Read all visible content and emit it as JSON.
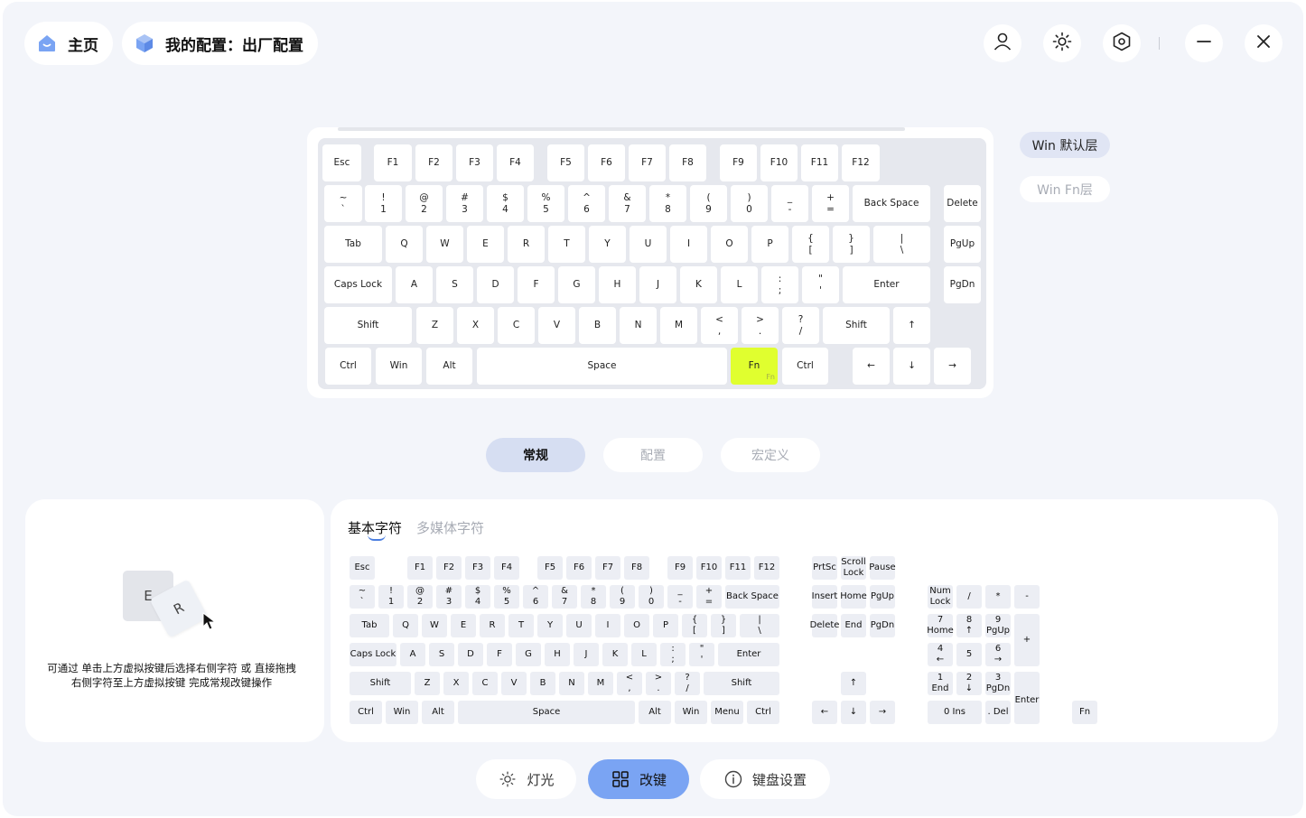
{
  "header": {
    "home_label": "主页",
    "config_label": "我的配置：出厂配置"
  },
  "layers": {
    "win_default": "Win 默认层",
    "win_fn": "Win Fn层"
  },
  "mid_tabs": [
    "常规",
    "配置",
    "宏定义"
  ],
  "keyboard": {
    "fn_sub": "Fn",
    "keys": [
      {
        "id": "esc",
        "t": [
          "Esc"
        ]
      },
      {
        "id": "f1",
        "t": [
          "F1"
        ]
      },
      {
        "id": "f2",
        "t": [
          "F2"
        ]
      },
      {
        "id": "f3",
        "t": [
          "F3"
        ]
      },
      {
        "id": "f4",
        "t": [
          "F4"
        ]
      },
      {
        "id": "f5",
        "t": [
          "F5"
        ]
      },
      {
        "id": "f6",
        "t": [
          "F6"
        ]
      },
      {
        "id": "f7",
        "t": [
          "F7"
        ]
      },
      {
        "id": "f8",
        "t": [
          "F8"
        ]
      },
      {
        "id": "f9",
        "t": [
          "F9"
        ]
      },
      {
        "id": "f10",
        "t": [
          "F10"
        ]
      },
      {
        "id": "f11",
        "t": [
          "F11"
        ]
      },
      {
        "id": "f12",
        "t": [
          "F12"
        ]
      },
      {
        "id": "grave",
        "t": [
          "~",
          "`"
        ]
      },
      {
        "id": "1",
        "t": [
          "!",
          "1"
        ]
      },
      {
        "id": "2",
        "t": [
          "@",
          "2"
        ]
      },
      {
        "id": "3",
        "t": [
          "#",
          "3"
        ]
      },
      {
        "id": "4",
        "t": [
          "$",
          "4"
        ]
      },
      {
        "id": "5",
        "t": [
          "%",
          "5"
        ]
      },
      {
        "id": "6",
        "t": [
          "^",
          "6"
        ]
      },
      {
        "id": "7",
        "t": [
          "&",
          "7"
        ]
      },
      {
        "id": "8",
        "t": [
          "*",
          "8"
        ]
      },
      {
        "id": "9",
        "t": [
          "(",
          "9"
        ]
      },
      {
        "id": "0",
        "t": [
          ")",
          "0"
        ]
      },
      {
        "id": "minus",
        "t": [
          "_",
          "-"
        ]
      },
      {
        "id": "equal",
        "t": [
          "+",
          "="
        ]
      },
      {
        "id": "backspace",
        "t": [
          "Back Space"
        ]
      },
      {
        "id": "delete",
        "t": [
          "Delete"
        ]
      },
      {
        "id": "tab",
        "t": [
          "Tab"
        ]
      },
      {
        "id": "q",
        "t": [
          "Q"
        ]
      },
      {
        "id": "w",
        "t": [
          "W"
        ]
      },
      {
        "id": "e",
        "t": [
          "E"
        ]
      },
      {
        "id": "r",
        "t": [
          "R"
        ]
      },
      {
        "id": "t",
        "t": [
          "T"
        ]
      },
      {
        "id": "y",
        "t": [
          "Y"
        ]
      },
      {
        "id": "u",
        "t": [
          "U"
        ]
      },
      {
        "id": "i",
        "t": [
          "I"
        ]
      },
      {
        "id": "o",
        "t": [
          "O"
        ]
      },
      {
        "id": "p",
        "t": [
          "P"
        ]
      },
      {
        "id": "lbracket",
        "t": [
          "{",
          "["
        ]
      },
      {
        "id": "rbracket",
        "t": [
          "}",
          "]"
        ]
      },
      {
        "id": "backslash",
        "t": [
          "|",
          "\\"
        ]
      },
      {
        "id": "pgup",
        "t": [
          "PgUp"
        ]
      },
      {
        "id": "capslock",
        "t": [
          "Caps Lock"
        ]
      },
      {
        "id": "a",
        "t": [
          "A"
        ]
      },
      {
        "id": "s",
        "t": [
          "S"
        ]
      },
      {
        "id": "d",
        "t": [
          "D"
        ]
      },
      {
        "id": "f",
        "t": [
          "F"
        ]
      },
      {
        "id": "g",
        "t": [
          "G"
        ]
      },
      {
        "id": "h",
        "t": [
          "H"
        ]
      },
      {
        "id": "j",
        "t": [
          "J"
        ]
      },
      {
        "id": "k",
        "t": [
          "K"
        ]
      },
      {
        "id": "l",
        "t": [
          "L"
        ]
      },
      {
        "id": "semicolon",
        "t": [
          ":",
          ";"
        ]
      },
      {
        "id": "quote",
        "t": [
          "\"",
          "'"
        ]
      },
      {
        "id": "enter",
        "t": [
          "Enter"
        ]
      },
      {
        "id": "pgdn",
        "t": [
          "PgDn"
        ]
      },
      {
        "id": "lshift",
        "t": [
          "Shift"
        ]
      },
      {
        "id": "z",
        "t": [
          "Z"
        ]
      },
      {
        "id": "x",
        "t": [
          "X"
        ]
      },
      {
        "id": "c",
        "t": [
          "C"
        ]
      },
      {
        "id": "v",
        "t": [
          "V"
        ]
      },
      {
        "id": "b",
        "t": [
          "B"
        ]
      },
      {
        "id": "n",
        "t": [
          "N"
        ]
      },
      {
        "id": "m",
        "t": [
          "M"
        ]
      },
      {
        "id": "comma",
        "t": [
          "<",
          ","
        ]
      },
      {
        "id": "period",
        "t": [
          ">",
          "."
        ]
      },
      {
        "id": "slash",
        "t": [
          "?",
          "/"
        ]
      },
      {
        "id": "rshift",
        "t": [
          "Shift"
        ]
      },
      {
        "id": "up",
        "t": [
          "↑"
        ]
      },
      {
        "id": "lctrl",
        "t": [
          "Ctrl"
        ]
      },
      {
        "id": "lwin",
        "t": [
          "Win"
        ]
      },
      {
        "id": "lalt",
        "t": [
          "Alt"
        ]
      },
      {
        "id": "space",
        "t": [
          "Space"
        ]
      },
      {
        "id": "fn",
        "t": [
          "Fn"
        ]
      },
      {
        "id": "rctrl",
        "t": [
          "Ctrl"
        ]
      },
      {
        "id": "left",
        "t": [
          "←"
        ]
      },
      {
        "id": "down",
        "t": [
          "↓"
        ]
      },
      {
        "id": "right",
        "t": [
          "→"
        ]
      }
    ]
  },
  "hint": {
    "line1": "可通过 单击上方虚拟按键后选择右侧字符 或 直接拖拽",
    "line2": "右侧字符至上方虚拟按键 完成常规改键操作",
    "illus_key1": "E",
    "illus_key2": "R"
  },
  "char_tabs": [
    "基本字符",
    "多媒体字符"
  ],
  "chars": {
    "keys": [
      {
        "id": "esc",
        "t": [
          "Esc"
        ]
      },
      {
        "id": "f1",
        "t": [
          "F1"
        ]
      },
      {
        "id": "f2",
        "t": [
          "F2"
        ]
      },
      {
        "id": "f3",
        "t": [
          "F3"
        ]
      },
      {
        "id": "f4",
        "t": [
          "F4"
        ]
      },
      {
        "id": "f5",
        "t": [
          "F5"
        ]
      },
      {
        "id": "f6",
        "t": [
          "F6"
        ]
      },
      {
        "id": "f7",
        "t": [
          "F7"
        ]
      },
      {
        "id": "f8",
        "t": [
          "F8"
        ]
      },
      {
        "id": "f9",
        "t": [
          "F9"
        ]
      },
      {
        "id": "f10",
        "t": [
          "F10"
        ]
      },
      {
        "id": "f11",
        "t": [
          "F11"
        ]
      },
      {
        "id": "f12",
        "t": [
          "F12"
        ]
      },
      {
        "id": "prtsc",
        "t": [
          "PrtSc"
        ]
      },
      {
        "id": "scroll",
        "t": [
          "Scroll",
          "Lock"
        ]
      },
      {
        "id": "pause",
        "t": [
          "Pause"
        ]
      },
      {
        "id": "grave",
        "t": [
          "~",
          "`"
        ]
      },
      {
        "id": "1",
        "t": [
          "!",
          "1"
        ]
      },
      {
        "id": "2",
        "t": [
          "@",
          "2"
        ]
      },
      {
        "id": "3",
        "t": [
          "#",
          "3"
        ]
      },
      {
        "id": "4",
        "t": [
          "$",
          "4"
        ]
      },
      {
        "id": "5",
        "t": [
          "%",
          "5"
        ]
      },
      {
        "id": "6",
        "t": [
          "^",
          "6"
        ]
      },
      {
        "id": "7",
        "t": [
          "&",
          "7"
        ]
      },
      {
        "id": "8",
        "t": [
          "*",
          "8"
        ]
      },
      {
        "id": "9",
        "t": [
          "(",
          "9"
        ]
      },
      {
        "id": "0",
        "t": [
          ")",
          "0"
        ]
      },
      {
        "id": "minus",
        "t": [
          "_",
          "-"
        ]
      },
      {
        "id": "equal",
        "t": [
          "+",
          "="
        ]
      },
      {
        "id": "backspace",
        "t": [
          "Back Space"
        ]
      },
      {
        "id": "insert",
        "t": [
          "Insert"
        ]
      },
      {
        "id": "home",
        "t": [
          "Home"
        ]
      },
      {
        "id": "pgup",
        "t": [
          "PgUp"
        ]
      },
      {
        "id": "numlock",
        "t": [
          "Num",
          "Lock"
        ]
      },
      {
        "id": "npdiv",
        "t": [
          "/"
        ]
      },
      {
        "id": "npmul",
        "t": [
          "*"
        ]
      },
      {
        "id": "npsub",
        "t": [
          "-"
        ]
      },
      {
        "id": "tab",
        "t": [
          "Tab"
        ]
      },
      {
        "id": "q",
        "t": [
          "Q"
        ]
      },
      {
        "id": "w",
        "t": [
          "W"
        ]
      },
      {
        "id": "e",
        "t": [
          "E"
        ]
      },
      {
        "id": "r",
        "t": [
          "R"
        ]
      },
      {
        "id": "t",
        "t": [
          "T"
        ]
      },
      {
        "id": "y",
        "t": [
          "Y"
        ]
      },
      {
        "id": "u",
        "t": [
          "U"
        ]
      },
      {
        "id": "i",
        "t": [
          "I"
        ]
      },
      {
        "id": "o",
        "t": [
          "O"
        ]
      },
      {
        "id": "p",
        "t": [
          "P"
        ]
      },
      {
        "id": "lbracket",
        "t": [
          "{",
          "["
        ]
      },
      {
        "id": "rbracket",
        "t": [
          "}",
          "]"
        ]
      },
      {
        "id": "backslash",
        "t": [
          "|",
          "\\"
        ]
      },
      {
        "id": "delete",
        "t": [
          "Delete"
        ]
      },
      {
        "id": "end",
        "t": [
          "End"
        ]
      },
      {
        "id": "pgdn",
        "t": [
          "PgDn"
        ]
      },
      {
        "id": "np7",
        "t": [
          "7",
          "Home"
        ]
      },
      {
        "id": "np8",
        "t": [
          "8",
          "↑"
        ]
      },
      {
        "id": "np9",
        "t": [
          "9",
          "PgUp"
        ]
      },
      {
        "id": "npadd",
        "t": [
          "+"
        ]
      },
      {
        "id": "capslock",
        "t": [
          "Caps Lock"
        ]
      },
      {
        "id": "a",
        "t": [
          "A"
        ]
      },
      {
        "id": "s",
        "t": [
          "S"
        ]
      },
      {
        "id": "d",
        "t": [
          "D"
        ]
      },
      {
        "id": "f",
        "t": [
          "F"
        ]
      },
      {
        "id": "g",
        "t": [
          "G"
        ]
      },
      {
        "id": "h",
        "t": [
          "H"
        ]
      },
      {
        "id": "j",
        "t": [
          "J"
        ]
      },
      {
        "id": "k",
        "t": [
          "K"
        ]
      },
      {
        "id": "l",
        "t": [
          "L"
        ]
      },
      {
        "id": "semicolon",
        "t": [
          ":",
          ";"
        ]
      },
      {
        "id": "quote",
        "t": [
          "\"",
          "'"
        ]
      },
      {
        "id": "enter",
        "t": [
          "Enter"
        ]
      },
      {
        "id": "np4",
        "t": [
          "4",
          "←"
        ]
      },
      {
        "id": "np5",
        "t": [
          "5"
        ]
      },
      {
        "id": "np6",
        "t": [
          "6",
          "→"
        ]
      },
      {
        "id": "lshift",
        "t": [
          "Shift"
        ]
      },
      {
        "id": "z",
        "t": [
          "Z"
        ]
      },
      {
        "id": "x",
        "t": [
          "X"
        ]
      },
      {
        "id": "c",
        "t": [
          "C"
        ]
      },
      {
        "id": "v",
        "t": [
          "V"
        ]
      },
      {
        "id": "b",
        "t": [
          "B"
        ]
      },
      {
        "id": "n",
        "t": [
          "N"
        ]
      },
      {
        "id": "m",
        "t": [
          "M"
        ]
      },
      {
        "id": "comma",
        "t": [
          "<",
          ","
        ]
      },
      {
        "id": "period",
        "t": [
          ">",
          "."
        ]
      },
      {
        "id": "slash",
        "t": [
          "?",
          "/"
        ]
      },
      {
        "id": "rshift",
        "t": [
          "Shift"
        ]
      },
      {
        "id": "up",
        "t": [
          "↑"
        ]
      },
      {
        "id": "np1",
        "t": [
          "1",
          "End"
        ]
      },
      {
        "id": "np2",
        "t": [
          "2",
          "↓"
        ]
      },
      {
        "id": "np3",
        "t": [
          "3",
          "PgDn"
        ]
      },
      {
        "id": "npenter",
        "t": [
          "Enter"
        ]
      },
      {
        "id": "lctrl",
        "t": [
          "Ctrl"
        ]
      },
      {
        "id": "lwin",
        "t": [
          "Win"
        ]
      },
      {
        "id": "lalt",
        "t": [
          "Alt"
        ]
      },
      {
        "id": "space",
        "t": [
          "Space"
        ]
      },
      {
        "id": "ralt",
        "t": [
          "Alt"
        ]
      },
      {
        "id": "rwin",
        "t": [
          "Win"
        ]
      },
      {
        "id": "menu",
        "t": [
          "Menu"
        ]
      },
      {
        "id": "rctrl",
        "t": [
          "Ctrl"
        ]
      },
      {
        "id": "left",
        "t": [
          "←"
        ]
      },
      {
        "id": "down",
        "t": [
          "↓"
        ]
      },
      {
        "id": "right",
        "t": [
          "→"
        ]
      },
      {
        "id": "np0",
        "t": [
          "0 Ins"
        ]
      },
      {
        "id": "npdel",
        "t": [
          ". Del"
        ]
      },
      {
        "id": "fn",
        "t": [
          "Fn"
        ]
      }
    ]
  },
  "bottom_nav": {
    "light": "灯光",
    "remap": "改键",
    "settings": "键盘设置"
  },
  "colors": {
    "accent": "#7aa4f3",
    "fn_active": "#e0ff2f",
    "layer_active": "#e0e5f4"
  }
}
